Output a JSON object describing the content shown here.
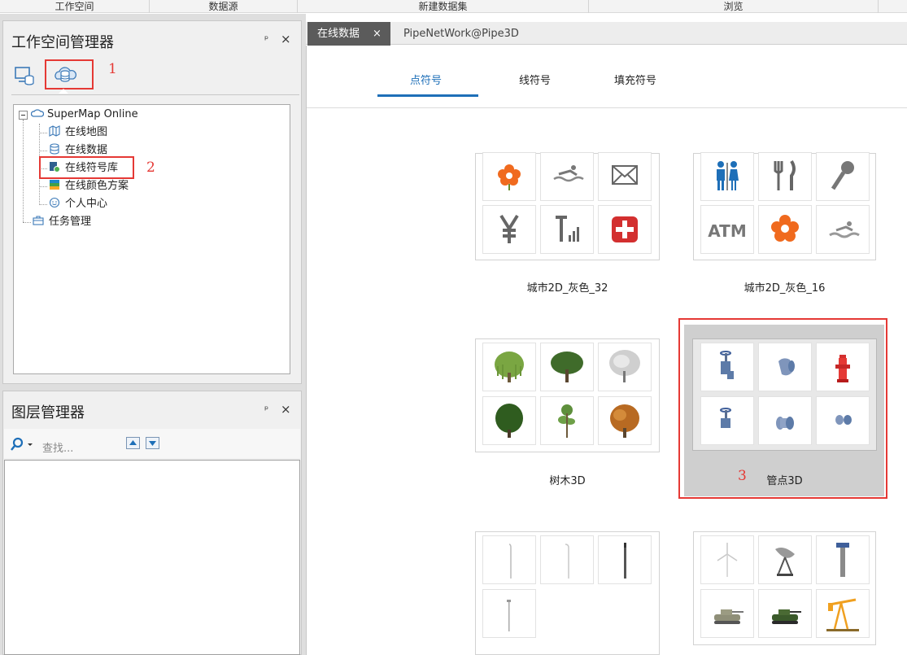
{
  "top_groups": [
    "工作空间",
    "数据源",
    "新建数据集",
    "浏览"
  ],
  "workspace_panel": {
    "title": "工作空间管理器",
    "pin_label": "ᵖ",
    "close_label": "×"
  },
  "tree": {
    "root": "SuperMap Online",
    "children": [
      "在线地图",
      "在线数据",
      "在线符号库",
      "在线颜色方案",
      "个人中心"
    ],
    "task": "任务管理"
  },
  "annotations": {
    "a1": "1",
    "a2": "2",
    "a3": "3"
  },
  "layer_panel": {
    "title": "图层管理器",
    "pin_label": "ᵖ",
    "close_label": "×",
    "search_placeholder": "查找..."
  },
  "doc_tabs": {
    "active": "在线数据",
    "close": "×",
    "inactive": "PipeNetWork@Pipe3D"
  },
  "symbol_tabs": [
    "点符号",
    "线符号",
    "填充符号"
  ],
  "libraries": [
    {
      "label": "城市2D_灰色_32",
      "icons": [
        "flower-icon",
        "swimming-icon",
        "mail-icon",
        "yen-icon",
        "signal-icon",
        "first-aid-icon"
      ]
    },
    {
      "label": "城市2D_灰色_16",
      "icons": [
        "restroom-icon",
        "dining-icon",
        "microphone-icon",
        "atm-icon",
        "flower-icon",
        "swimming-icon"
      ]
    },
    {
      "label": "树木3D",
      "icons": [
        "willow-tree-icon",
        "oak-tree-icon",
        "snowy-tree-icon",
        "bush-tree-icon",
        "thin-tree-icon",
        "autumn-tree-icon"
      ]
    },
    {
      "label": "管点3D",
      "icons": [
        "valve-icon",
        "elbow-pipe-icon",
        "fire-hydrant-icon",
        "valve-icon",
        "flange-pipe-icon",
        "pipe-joint-icon"
      ]
    },
    {
      "label": "",
      "icons": [
        "street-lamp-icon",
        "street-lamp-icon",
        "pole-icon",
        "street-lamp-icon"
      ]
    },
    {
      "label": "",
      "icons": [
        "wind-turbine-icon",
        "satellite-dish-icon",
        "tower-icon",
        "tank-icon",
        "tank-icon",
        "pumpjack-icon"
      ]
    }
  ],
  "colors": {
    "accent": "#1e6fb8",
    "annotation": "#e53935",
    "tab_active": "#5b5b5b"
  }
}
